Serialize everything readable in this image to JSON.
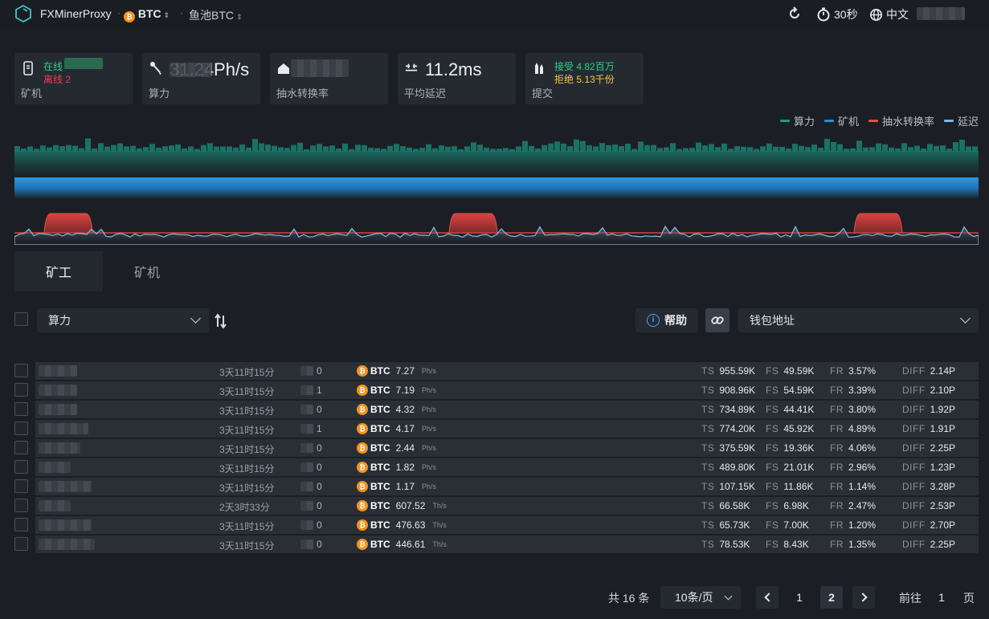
{
  "header": {
    "app_title": "FXMinerProxy",
    "coin": "BTC",
    "pool": "鱼池BTC",
    "refresh_interval": "30秒",
    "language": "中文"
  },
  "stats": {
    "miners": {
      "online": "在线",
      "offline": "离线 2",
      "label": "矿机"
    },
    "hashrate": {
      "value": "31.24Ph/s",
      "label": "算力"
    },
    "fee_rate": {
      "label": "抽水转换率"
    },
    "latency": {
      "value": "11.2ms",
      "label": "平均延迟"
    },
    "shares": {
      "accepted": "接受 4.82百万",
      "rejected": "拒绝 5.13千份",
      "label": "提交"
    }
  },
  "legend": [
    {
      "label": "算力",
      "color": "#1f9c80"
    },
    {
      "label": "矿机",
      "color": "#2d8fd8"
    },
    {
      "label": "抽水转换率",
      "color": "#e2504c"
    },
    {
      "label": "延迟",
      "color": "#7fb6e6"
    }
  ],
  "tabs": [
    {
      "label": "矿工"
    },
    {
      "label": "矿机"
    }
  ],
  "toolbar": {
    "sort_field": "算力",
    "help_label": "帮助",
    "wallet_placeholder": "钱包地址"
  },
  "table": {
    "rows": [
      {
        "uptime": "3天11时15分",
        "count": "0",
        "coin": "BTC",
        "hashrate": "7.27",
        "unit": "Ph/s",
        "ts": "955.59K",
        "fs": "49.59K",
        "fr": "3.57%",
        "diff": "2.14P"
      },
      {
        "uptime": "3天11时15分",
        "count": "1",
        "coin": "BTC",
        "hashrate": "7.19",
        "unit": "Ph/s",
        "ts": "908.96K",
        "fs": "54.59K",
        "fr": "3.39%",
        "diff": "2.10P"
      },
      {
        "uptime": "3天11时15分",
        "count": "0",
        "coin": "BTC",
        "hashrate": "4.32",
        "unit": "Ph/s",
        "ts": "734.89K",
        "fs": "44.41K",
        "fr": "3.80%",
        "diff": "1.92P"
      },
      {
        "uptime": "3天11时15分",
        "count": "1",
        "coin": "BTC",
        "hashrate": "4.17",
        "unit": "Ph/s",
        "ts": "774.20K",
        "fs": "45.92K",
        "fr": "4.89%",
        "diff": "1.91P"
      },
      {
        "uptime": "3天11时15分",
        "count": "0",
        "coin": "BTC",
        "hashrate": "2.44",
        "unit": "Ph/s",
        "ts": "375.59K",
        "fs": "19.36K",
        "fr": "4.06%",
        "diff": "2.25P"
      },
      {
        "uptime": "3天11时15分",
        "count": "0",
        "coin": "BTC",
        "hashrate": "1.82",
        "unit": "Ph/s",
        "ts": "489.80K",
        "fs": "21.01K",
        "fr": "2.96%",
        "diff": "1.23P"
      },
      {
        "uptime": "3天11时15分",
        "count": "0",
        "coin": "BTC",
        "hashrate": "1.17",
        "unit": "Ph/s",
        "ts": "107.15K",
        "fs": "11.86K",
        "fr": "1.14%",
        "diff": "3.28P"
      },
      {
        "uptime": "2天3时33分",
        "count": "0",
        "coin": "BTC",
        "hashrate": "607.52",
        "unit": "Th/s",
        "ts": "66.58K",
        "fs": "6.98K",
        "fr": "2.47%",
        "diff": "2.53P"
      },
      {
        "uptime": "3天11时15分",
        "count": "0",
        "coin": "BTC",
        "hashrate": "476.63",
        "unit": "Th/s",
        "ts": "65.73K",
        "fs": "7.00K",
        "fr": "1.20%",
        "diff": "2.70P"
      },
      {
        "uptime": "3天11时15分",
        "count": "0",
        "coin": "BTC",
        "hashrate": "446.61",
        "unit": "Th/s",
        "ts": "78.53K",
        "fs": "8.43K",
        "fr": "1.35%",
        "diff": "2.25P"
      }
    ],
    "keys": {
      "ts": "TS",
      "fs": "FS",
      "fr": "FR",
      "diff": "DIFF"
    }
  },
  "pagination": {
    "total": "共 16 条",
    "page_size": "10条/页",
    "pages": [
      "1",
      "2"
    ],
    "goto_prefix": "前往",
    "goto_value": "1",
    "goto_suffix": "页"
  }
}
